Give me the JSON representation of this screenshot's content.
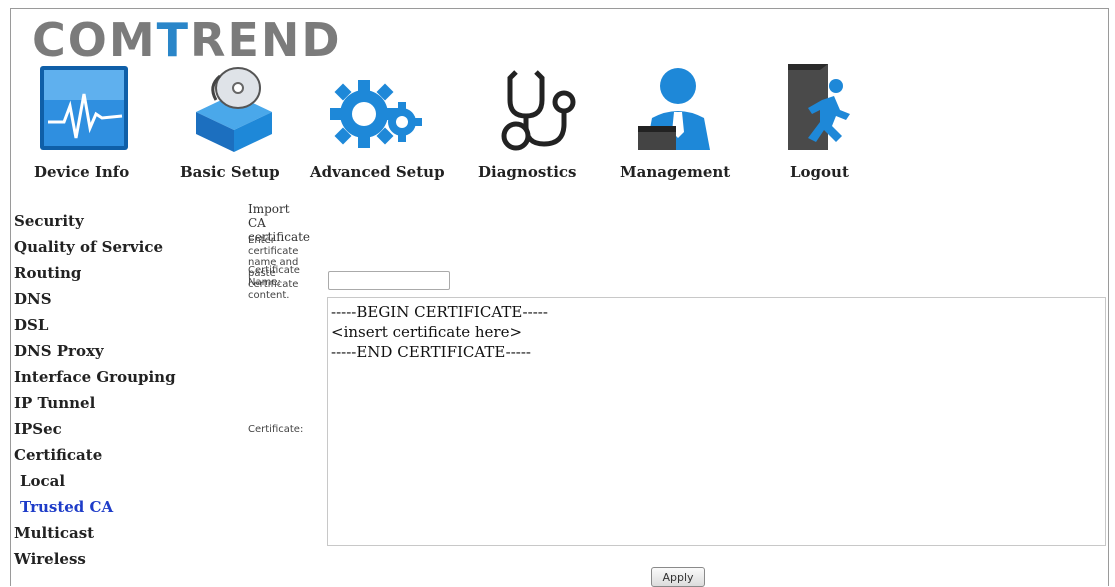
{
  "logo": {
    "text_a": "COM",
    "text_b": "T",
    "text_c": "REND"
  },
  "nav": [
    {
      "label": "Device Info",
      "icon": "device-info-icon"
    },
    {
      "label": "Basic Setup",
      "icon": "basic-setup-icon"
    },
    {
      "label": "Advanced Setup",
      "icon": "advanced-setup-icon",
      "active": true
    },
    {
      "label": "Diagnostics",
      "icon": "stethoscope-icon"
    },
    {
      "label": "Management",
      "icon": "management-icon"
    },
    {
      "label": "Logout",
      "icon": "logout-icon"
    }
  ],
  "sidebar": [
    {
      "label": "Security"
    },
    {
      "label": "Quality of Service"
    },
    {
      "label": "Routing"
    },
    {
      "label": "DNS"
    },
    {
      "label": "DSL"
    },
    {
      "label": "DNS Proxy"
    },
    {
      "label": "Interface Grouping"
    },
    {
      "label": "IP Tunnel"
    },
    {
      "label": "IPSec"
    },
    {
      "label": "Certificate"
    },
    {
      "label": "Local",
      "sub": true
    },
    {
      "label": "Trusted CA",
      "sub": true,
      "active": true
    },
    {
      "label": "Multicast"
    },
    {
      "label": "Wireless"
    }
  ],
  "form": {
    "title": "Import CA certificate",
    "instructions": "Enter certificate name and paste certificate content.",
    "cert_name_label": "Certificate Name:",
    "cert_name_value": "",
    "cert_label": "Certificate:",
    "cert_value": "-----BEGIN CERTIFICATE-----\n<insert certificate here>\n-----END CERTIFICATE-----",
    "apply_label": "Apply"
  },
  "colors": {
    "active_link": "#1e3cc8",
    "logo_gray": "#7b7b7b",
    "logo_accent": "#2a86c9",
    "icon_blue": "#1e88d8"
  }
}
